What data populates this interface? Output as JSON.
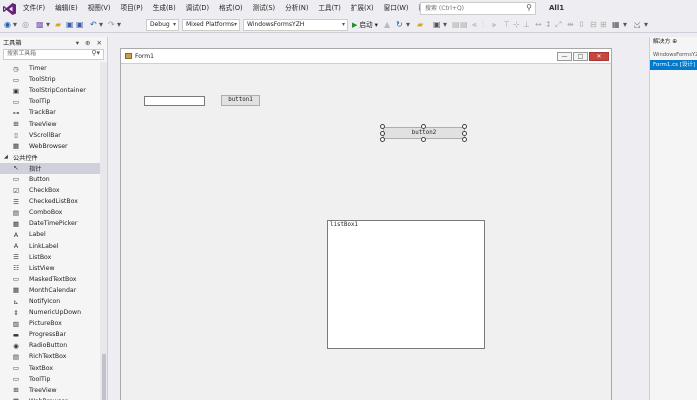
{
  "menubar": {
    "items": [
      "文件(F)",
      "编辑(E)",
      "视图(V)",
      "项目(P)",
      "生成(B)",
      "调试(D)",
      "格式(O)",
      "测试(S)",
      "分析(N)",
      "工具(T)",
      "扩展(X)",
      "窗口(W)",
      "帮助(H)"
    ],
    "search_placeholder": "搜索 (Ctrl+Q)",
    "all_label": "All1"
  },
  "toolbar": {
    "config": "Debug",
    "platform": "Mixed Platforms",
    "project": "WindowsFormsYZH",
    "start_label": "启动"
  },
  "toolbox": {
    "title": "工具箱",
    "header_icons": "▾ ⊕ ✕",
    "search_placeholder": "搜索工具箱",
    "rows": [
      {
        "label": "Timer",
        "icon": "timer-icon",
        "glyph": "◷",
        "group": false,
        "selected": false
      },
      {
        "label": "ToolStrip",
        "icon": "toolstrip-icon",
        "glyph": "▭",
        "group": false,
        "selected": false
      },
      {
        "label": "ToolStripContainer",
        "icon": "toolstripcontainer-icon",
        "glyph": "▣",
        "group": false,
        "selected": false
      },
      {
        "label": "ToolTip",
        "icon": "tooltip-icon",
        "glyph": "▭",
        "group": false,
        "selected": false
      },
      {
        "label": "TrackBar",
        "icon": "trackbar-icon",
        "glyph": "⊶",
        "group": false,
        "selected": false
      },
      {
        "label": "TreeView",
        "icon": "treeview-icon",
        "glyph": "⊞",
        "group": false,
        "selected": false
      },
      {
        "label": "VScrollBar",
        "icon": "vscrollbar-icon",
        "glyph": "▯",
        "group": false,
        "selected": false
      },
      {
        "label": "WebBrowser",
        "icon": "webbrowser-icon",
        "glyph": "▦",
        "group": false,
        "selected": false
      },
      {
        "label": "公共控件",
        "icon": "collapse-triangle-icon",
        "glyph": "◢",
        "group": true,
        "selected": false
      },
      {
        "label": "指针",
        "icon": "pointer-icon",
        "glyph": "↖",
        "group": false,
        "selected": true
      },
      {
        "label": "Button",
        "icon": "button-icon",
        "glyph": "▭",
        "group": false,
        "selected": false
      },
      {
        "label": "CheckBox",
        "icon": "checkbox-icon",
        "glyph": "☑",
        "group": false,
        "selected": false
      },
      {
        "label": "CheckedListBox",
        "icon": "checkedlistbox-icon",
        "glyph": "☰",
        "group": false,
        "selected": false
      },
      {
        "label": "ComboBox",
        "icon": "combobox-icon",
        "glyph": "▤",
        "group": false,
        "selected": false
      },
      {
        "label": "DateTimePicker",
        "icon": "datetimepicker-icon",
        "glyph": "▦",
        "group": false,
        "selected": false
      },
      {
        "label": "Label",
        "icon": "label-icon",
        "glyph": "A",
        "group": false,
        "selected": false
      },
      {
        "label": "LinkLabel",
        "icon": "linklabel-icon",
        "glyph": "A",
        "group": false,
        "selected": false
      },
      {
        "label": "ListBox",
        "icon": "listbox-icon",
        "glyph": "☰",
        "group": false,
        "selected": false
      },
      {
        "label": "ListView",
        "icon": "listview-icon",
        "glyph": "☷",
        "group": false,
        "selected": false
      },
      {
        "label": "MaskedTextBox",
        "icon": "maskedtextbox-icon",
        "glyph": "▭",
        "group": false,
        "selected": false
      },
      {
        "label": "MonthCalendar",
        "icon": "monthcalendar-icon",
        "glyph": "▦",
        "group": false,
        "selected": false
      },
      {
        "label": "NotifyIcon",
        "icon": "notifyicon-icon",
        "glyph": "⊾",
        "group": false,
        "selected": false
      },
      {
        "label": "NumericUpDown",
        "icon": "numericupdown-icon",
        "glyph": "⇕",
        "group": false,
        "selected": false
      },
      {
        "label": "PictureBox",
        "icon": "picturebox-icon",
        "glyph": "▨",
        "group": false,
        "selected": false
      },
      {
        "label": "ProgressBar",
        "icon": "progressbar-icon",
        "glyph": "▬",
        "group": false,
        "selected": false
      },
      {
        "label": "RadioButton",
        "icon": "radiobutton-icon",
        "glyph": "◉",
        "group": false,
        "selected": false
      },
      {
        "label": "RichTextBox",
        "icon": "richtextbox-icon",
        "glyph": "▤",
        "group": false,
        "selected": false
      },
      {
        "label": "TextBox",
        "icon": "textbox-icon",
        "glyph": "▭",
        "group": false,
        "selected": false
      },
      {
        "label": "ToolTip",
        "icon": "tooltip-icon",
        "glyph": "▭",
        "group": false,
        "selected": false
      },
      {
        "label": "TreeView",
        "icon": "treeview-icon",
        "glyph": "⊞",
        "group": false,
        "selected": false
      },
      {
        "label": "WebBrowser",
        "icon": "webbrowser-icon",
        "glyph": "▦",
        "group": false,
        "selected": false
      }
    ]
  },
  "designer": {
    "form_title": "Form1",
    "button1_label": "button1",
    "button2_label": "button2",
    "listbox1_label": "listBox1"
  },
  "solution": {
    "title": "解决方 ⊕",
    "project": "WindowsFormsYZH",
    "file": "Form1.cs [设计]"
  },
  "colors": {
    "accent": "#007acc",
    "selected_row": "#cfd0dc",
    "close_button": "#c9463d",
    "vs_purple": "#68217a"
  }
}
